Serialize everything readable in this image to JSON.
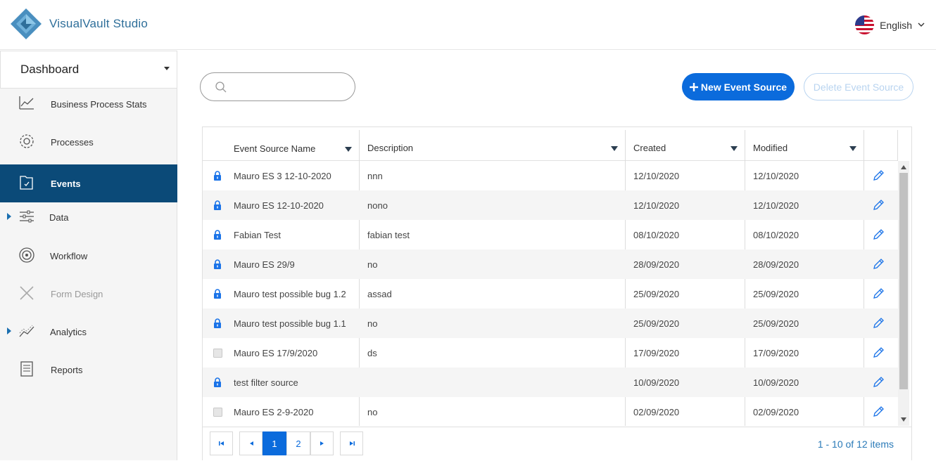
{
  "app": {
    "title": "VisualVault Studio"
  },
  "header": {
    "language": "English"
  },
  "sidebar": {
    "dashboard": "Dashboard",
    "items": [
      {
        "label": "Business Process Stats",
        "icon": "chart-line-icon"
      },
      {
        "label": "Processes",
        "icon": "gear-icon"
      },
      {
        "label": "Events",
        "icon": "folder-event-icon",
        "active": true
      },
      {
        "label": "Data",
        "icon": "sliders-icon",
        "expandable": true
      },
      {
        "label": "Workflow",
        "icon": "workflow-icon"
      },
      {
        "label": "Form Design",
        "icon": "tools-icon",
        "disabled": true
      },
      {
        "label": "Analytics",
        "icon": "analytics-icon",
        "expandable": true
      },
      {
        "label": "Reports",
        "icon": "report-icon"
      }
    ]
  },
  "toolbar": {
    "search_placeholder": "",
    "new_label": "New Event Source",
    "delete_label": "Delete Event Source"
  },
  "table": {
    "columns": [
      "Event Source Name",
      "Description",
      "Created",
      "Modified"
    ],
    "rows": [
      {
        "locked": true,
        "name": "Mauro ES 3 12-10-2020",
        "description": "nnn",
        "created": "12/10/2020",
        "modified": "12/10/2020"
      },
      {
        "locked": true,
        "name": "Mauro ES 12-10-2020",
        "description": "nono",
        "created": "12/10/2020",
        "modified": "12/10/2020"
      },
      {
        "locked": true,
        "name": "Fabian Test",
        "description": "fabian test",
        "created": "08/10/2020",
        "modified": "08/10/2020"
      },
      {
        "locked": true,
        "name": "Mauro ES 29/9",
        "description": "no",
        "created": "28/09/2020",
        "modified": "28/09/2020"
      },
      {
        "locked": true,
        "name": "Mauro test possible bug 1.2",
        "description": "assad",
        "created": "25/09/2020",
        "modified": "25/09/2020"
      },
      {
        "locked": true,
        "name": "Mauro test possible bug 1.1",
        "description": "no",
        "created": "25/09/2020",
        "modified": "25/09/2020"
      },
      {
        "locked": false,
        "name": "Mauro ES 17/9/2020",
        "description": "ds",
        "created": "17/09/2020",
        "modified": "17/09/2020"
      },
      {
        "locked": true,
        "name": "test filter source",
        "description": "",
        "created": "10/09/2020",
        "modified": "10/09/2020"
      },
      {
        "locked": false,
        "name": "Mauro ES 2-9-2020",
        "description": "no",
        "created": "02/09/2020",
        "modified": "02/09/2020"
      }
    ]
  },
  "pager": {
    "pages": [
      "1",
      "2"
    ],
    "current": "1",
    "info": "1 - 10 of 12 items"
  },
  "colors": {
    "primary": "#0b6bdc",
    "nav_active": "#0b4a78",
    "brand": "#2f6f9a"
  }
}
